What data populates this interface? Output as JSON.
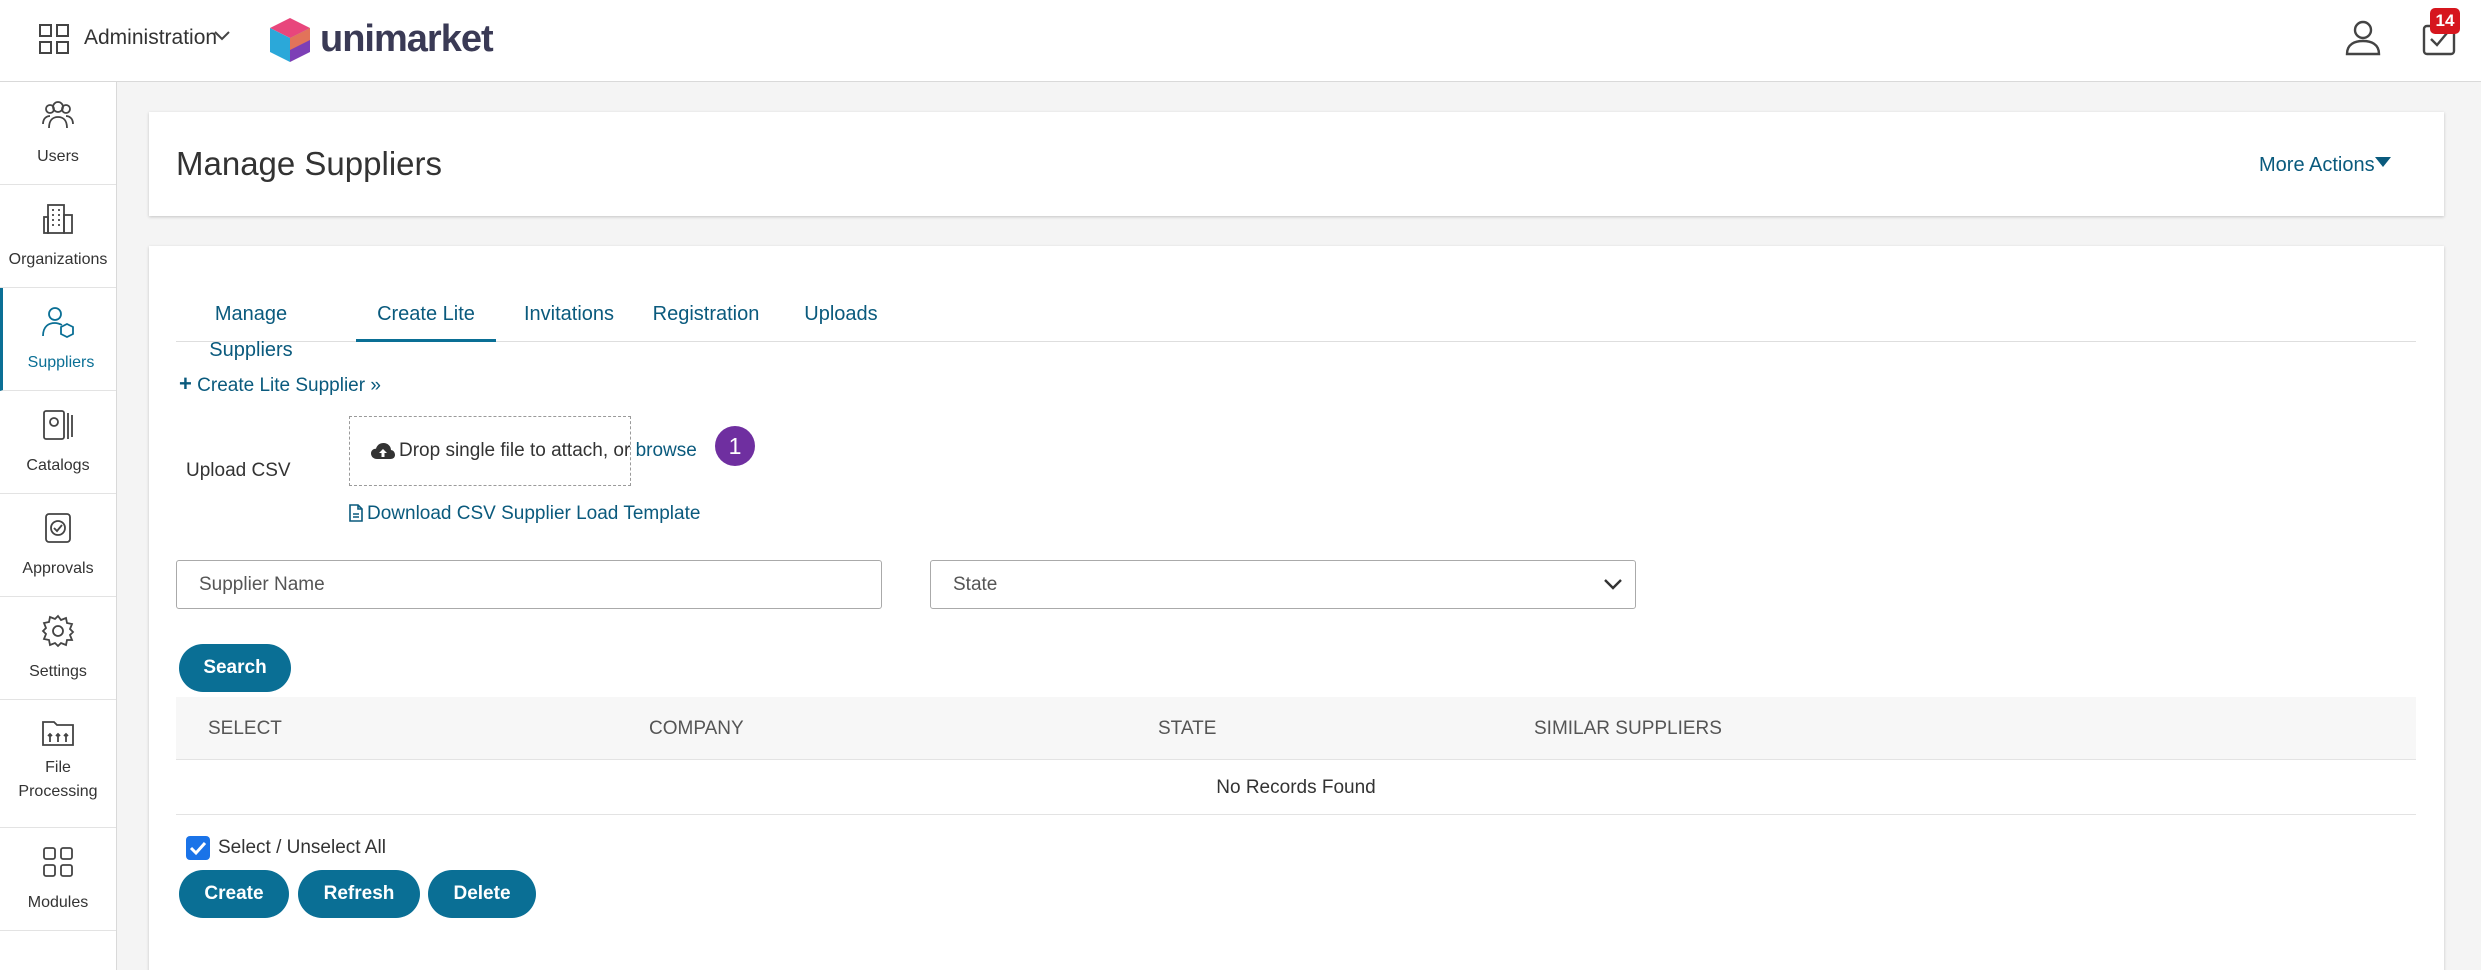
{
  "topbar": {
    "workspace_label": "Administration",
    "logo_text": "unimarket",
    "notification_count": "14"
  },
  "sidebar": {
    "items": [
      {
        "label": "Users",
        "icon": "users-icon"
      },
      {
        "label": "Organizations",
        "icon": "building-icon"
      },
      {
        "label": "Suppliers",
        "icon": "supplier-icon",
        "active": true
      },
      {
        "label": "Catalogs",
        "icon": "catalog-icon"
      },
      {
        "label": "Approvals",
        "icon": "approval-icon"
      },
      {
        "label": "Settings",
        "icon": "gear-icon"
      },
      {
        "label": "File Processing",
        "label_line1": "File",
        "label_line2": "Processing",
        "icon": "folder-icon"
      },
      {
        "label": "Modules",
        "icon": "modules-icon"
      }
    ]
  },
  "header": {
    "title": "Manage Suppliers",
    "more_actions": "More Actions"
  },
  "tabs": [
    {
      "label": "Manage Suppliers"
    },
    {
      "label": "Create Lite",
      "active": true
    },
    {
      "label": "Invitations"
    },
    {
      "label": "Registration"
    },
    {
      "label": "Uploads"
    }
  ],
  "create_lite": {
    "create_link": "Create Lite Supplier »",
    "upload_label": "Upload CSV",
    "drop_text": "Drop single file to attach, or",
    "browse_text": "browse",
    "step_number": "1",
    "template_link": "Download CSV Supplier Load Template"
  },
  "filters": {
    "supplier_name_placeholder": "Supplier Name",
    "state_selected": "State",
    "search_label": "Search"
  },
  "table": {
    "columns": [
      "SELECT",
      "COMPANY",
      "STATE",
      "SIMILAR SUPPLIERS"
    ],
    "empty_text": "No Records Found"
  },
  "actions": {
    "select_all_label": "Select / Unselect All",
    "select_all_checked": true,
    "create_label": "Create",
    "refresh_label": "Refresh",
    "delete_label": "Delete"
  },
  "colors": {
    "primary": "#0a6f95",
    "link": "#0a5a7d",
    "badge_red": "#d6161e",
    "step_purple": "#6f2fa0"
  }
}
